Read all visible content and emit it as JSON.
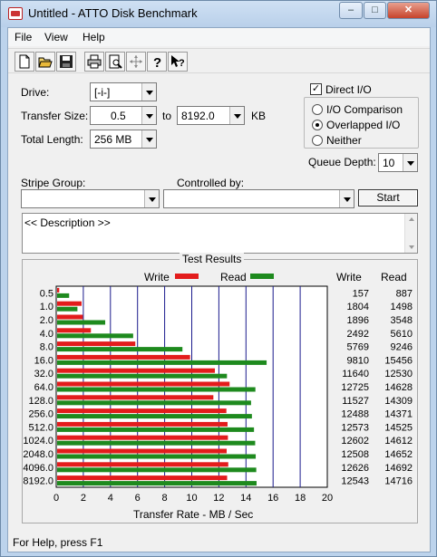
{
  "window": {
    "title": "Untitled - ATTO Disk Benchmark",
    "status": "For Help, press F1"
  },
  "menu": {
    "file": "File",
    "view": "View",
    "help": "Help"
  },
  "toolbar_icons": [
    "new-icon",
    "open-icon",
    "save-icon",
    "print-icon",
    "print-preview-icon",
    "move-icon",
    "help-icon",
    "context-help-icon"
  ],
  "settings": {
    "drive_label": "Drive:",
    "drive_value": "[-i-]",
    "transfer_size_label": "Transfer Size:",
    "transfer_from": "0.5",
    "to_label": "to",
    "transfer_to": "8192.0",
    "kb_label": "KB",
    "total_length_label": "Total Length:",
    "total_length_value": "256 MB",
    "direct_io_label": "Direct I/O",
    "direct_io_checked": true,
    "io_comparison_label": "I/O Comparison",
    "overlapped_io_label": "Overlapped I/O",
    "neither_label": "Neither",
    "selected_mode": "Overlapped I/O",
    "queue_depth_label": "Queue Depth:",
    "queue_depth_value": "10",
    "stripe_group_label": "Stripe Group:",
    "stripe_group_value": "",
    "controlled_by_label": "Controlled by:",
    "controlled_by_value": "",
    "start_label": "Start",
    "description": "<< Description >>"
  },
  "chart_data": {
    "type": "bar",
    "title": "Test Results",
    "xlabel": "Transfer Rate - MB / Sec",
    "xlim": [
      0,
      20
    ],
    "xticks": [
      "0",
      "2",
      "4",
      "6",
      "8",
      "10",
      "12",
      "14",
      "16",
      "18",
      "20"
    ],
    "legend": [
      {
        "name": "Write",
        "color": "#e31c1c"
      },
      {
        "name": "Read",
        "color": "#1e8a1e"
      }
    ],
    "col_write": "Write",
    "col_read": "Read",
    "categories": [
      "0.5",
      "1.0",
      "2.0",
      "4.0",
      "8.0",
      "16.0",
      "32.0",
      "64.0",
      "128.0",
      "256.0",
      "512.0",
      "1024.0",
      "2048.0",
      "4096.0",
      "8192.0"
    ],
    "series": [
      {
        "name": "Write",
        "values": [
          157,
          1804,
          1896,
          2492,
          5769,
          9810,
          11640,
          12725,
          11527,
          12488,
          12573,
          12602,
          12508,
          12626,
          12543
        ]
      },
      {
        "name": "Read",
        "values": [
          887,
          1498,
          3548,
          5610,
          9246,
          15456,
          12530,
          14628,
          14309,
          14371,
          14525,
          14612,
          14652,
          14692,
          14716
        ]
      }
    ],
    "write_text": [
      "157",
      "1804",
      "1896",
      "2492",
      "5769",
      "9810",
      "11640",
      "12725",
      "11527",
      "12488",
      "12573",
      "12602",
      "12508",
      "12626",
      "12543"
    ],
    "read_text": [
      "887",
      "1498",
      "3548",
      "5610",
      "9246",
      "15456",
      "12530",
      "14628",
      "14309",
      "14371",
      "14525",
      "14612",
      "14652",
      "14692",
      "14716"
    ]
  }
}
